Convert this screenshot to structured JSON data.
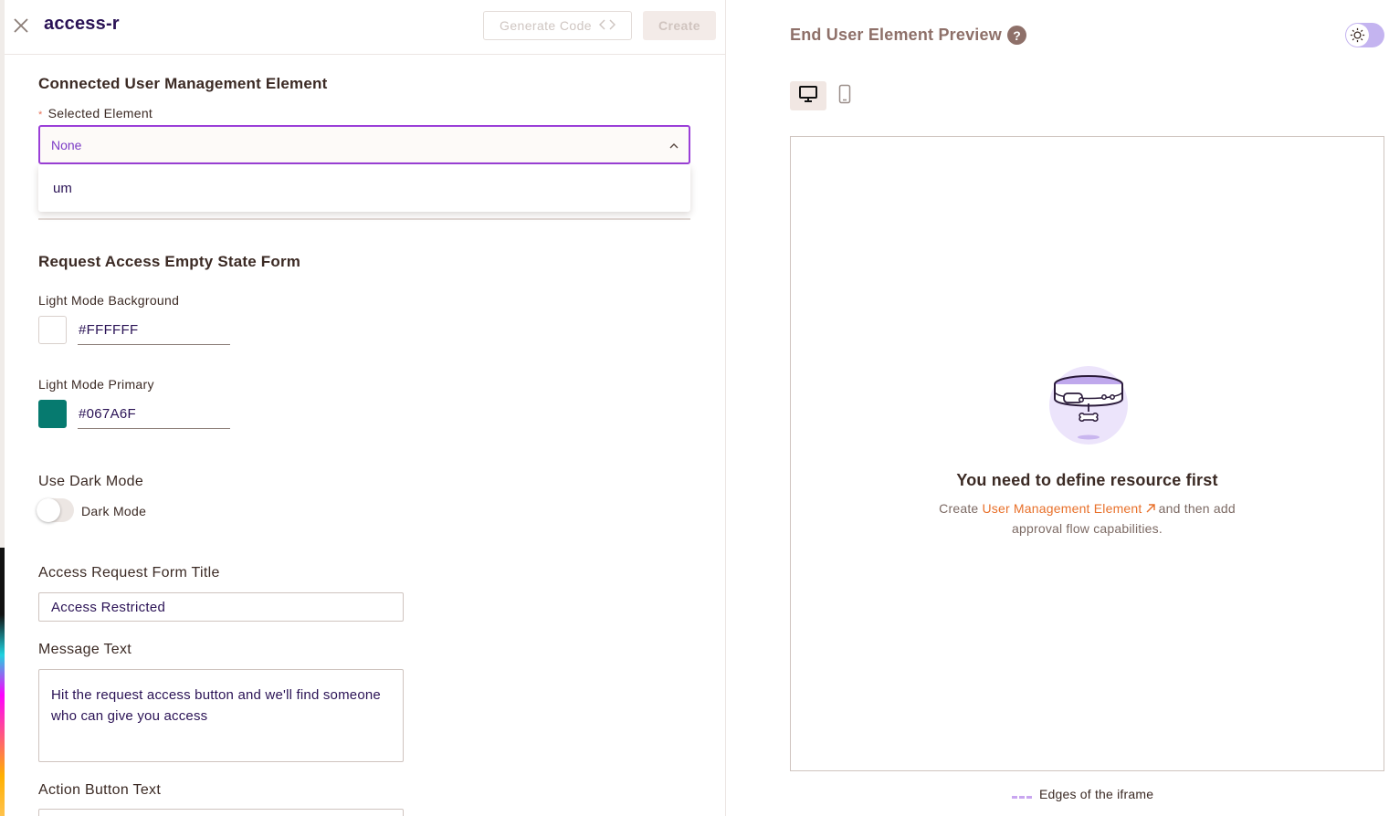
{
  "topbar": {
    "title": "access-r",
    "generate_code_label": "Generate Code",
    "create_label": "Create"
  },
  "connected": {
    "section_title": "Connected User Management Element",
    "selected_label": "Selected Element",
    "selected_value": "None",
    "options": [
      "um"
    ]
  },
  "form": {
    "section_title": "Request Access Empty State Form",
    "bg_label": "Light Mode Background",
    "bg_color": "#FFFFFF",
    "primary_label": "Light Mode Primary",
    "primary_color": "#067A6F",
    "dark_mode_section": "Use Dark Mode",
    "dark_mode_label": "Dark Mode",
    "form_title_label": "Access Request Form Title",
    "form_title_value": "Access Restricted",
    "message_label": "Message Text",
    "message_value": "Hit the request access button and we'll find someone who can give you access",
    "action_label": "Action Button Text"
  },
  "preview": {
    "title": "End User Element Preview",
    "help": "?",
    "empty_title": "You need to define resource first",
    "empty_text_pre": "Create ",
    "empty_link": "User Management Element",
    "empty_text_post": " and then add approval flow capabilities.",
    "edges_label": "Edges of the iframe"
  }
}
